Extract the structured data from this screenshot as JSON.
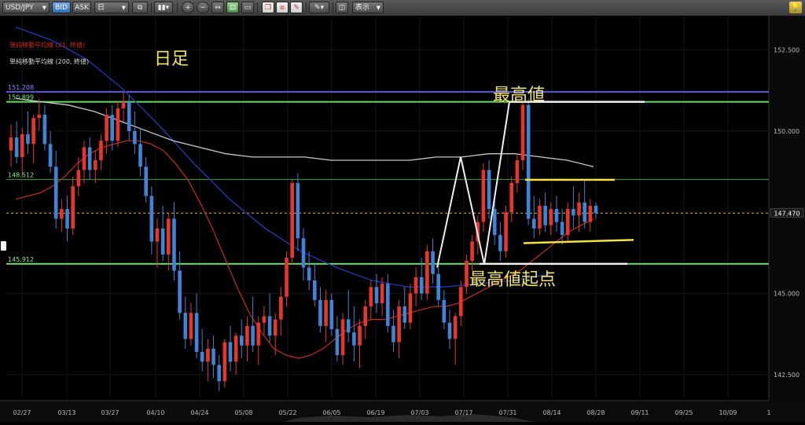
{
  "toolbar": {
    "symbol": "USD/JPY",
    "bid_label": "BID",
    "ask_label": "ASK",
    "timeframe": "日",
    "display_label": "表示",
    "icons": [
      "compare-icon",
      "chart-type-icon",
      "zoom-in-icon",
      "zoom-out-icon",
      "fit-icon",
      "window-icon",
      "copy-icon",
      "paste-icon",
      "delete-icon",
      "pen-icon",
      "screenshot-icon",
      "bulb-icon"
    ]
  },
  "colors": {
    "bull": "#e8362b",
    "bear": "#3f84d8",
    "sma21": "#cc2a1e",
    "sma200": "#c9c9c9",
    "blue_ma": "#1f3bb8",
    "resistance_line": "#5b5bd6",
    "green_line": "#5fe05f",
    "thin_green_line": "#3aa83a",
    "price_line": "#d4a23a",
    "annotation_text": "#f1e46b",
    "white_marker": "#f0f0f0",
    "yellow_marker": "#f2e23f"
  },
  "legend": {
    "sma21": "単純移動平均線 (21, 終値)",
    "sma200": "単純移動平均線 (200, 終値)"
  },
  "annotations": {
    "timeframe_label": "日足",
    "high_label": "最高値",
    "high_origin_label": "最高値起点"
  },
  "price_labels": {
    "resistance": "151.208",
    "upper_green": "150.899",
    "mid_green": "148.512",
    "lower_green": "145.912",
    "current": "147.470"
  },
  "chart_data": {
    "type": "candlestick",
    "title": "",
    "x_tick_labels": [
      "02/27",
      "03/13",
      "03/27",
      "04/10",
      "04/24",
      "05/08",
      "05/22",
      "06/05",
      "06/19",
      "07/03",
      "07/17",
      "07/31",
      "08/14",
      "08/28",
      "09/11",
      "09/25",
      "10/09",
      "1"
    ],
    "y_tick_labels": [
      "152.500",
      "150.000",
      "147.500",
      "145.000",
      "142.500"
    ],
    "ylim": [
      141.7,
      153.55
    ],
    "horizontal_levels": {
      "resistance": 151.208,
      "upper_green": 150.899,
      "mid_green": 148.512,
      "lower_green": 145.912,
      "current": 147.47
    },
    "candles": [
      [
        149.4,
        150.2,
        148.9,
        149.8
      ],
      [
        149.8,
        150.3,
        149.0,
        149.2
      ],
      [
        149.2,
        150.1,
        148.6,
        149.9
      ],
      [
        149.9,
        150.6,
        149.3,
        149.6
      ],
      [
        149.6,
        150.5,
        149.0,
        150.4
      ],
      [
        150.4,
        151.0,
        150.0,
        150.5
      ],
      [
        150.5,
        150.8,
        149.4,
        149.6
      ],
      [
        149.6,
        150.0,
        148.7,
        148.9
      ],
      [
        148.9,
        149.4,
        147.0,
        147.3
      ],
      [
        147.3,
        147.9,
        146.9,
        147.6
      ],
      [
        147.6,
        148.0,
        146.6,
        147.0
      ],
      [
        147.0,
        148.6,
        146.8,
        148.3
      ],
      [
        148.3,
        149.2,
        148.0,
        148.8
      ],
      [
        148.8,
        149.7,
        148.4,
        149.5
      ],
      [
        149.5,
        149.8,
        148.5,
        148.8
      ],
      [
        148.8,
        149.4,
        148.4,
        149.1
      ],
      [
        149.1,
        149.9,
        148.8,
        149.7
      ],
      [
        149.7,
        150.7,
        149.3,
        150.5
      ],
      [
        150.5,
        150.8,
        149.4,
        149.7
      ],
      [
        149.7,
        150.9,
        149.5,
        150.7
      ],
      [
        150.7,
        151.2,
        150.3,
        150.9
      ],
      [
        150.9,
        151.1,
        149.7,
        150.0
      ],
      [
        150.0,
        150.6,
        149.3,
        149.6
      ],
      [
        149.6,
        150.1,
        148.6,
        148.9
      ],
      [
        148.9,
        149.2,
        147.8,
        148.0
      ],
      [
        148.0,
        148.3,
        146.2,
        146.6
      ],
      [
        146.6,
        147.3,
        145.8,
        147.0
      ],
      [
        147.0,
        147.7,
        146.0,
        146.2
      ],
      [
        146.2,
        147.5,
        145.7,
        147.3
      ],
      [
        147.3,
        147.8,
        145.4,
        145.7
      ],
      [
        145.7,
        146.3,
        144.2,
        144.4
      ],
      [
        144.4,
        144.9,
        143.3,
        143.6
      ],
      [
        143.6,
        144.7,
        143.4,
        144.4
      ],
      [
        144.4,
        145.0,
        143.0,
        143.2
      ],
      [
        143.2,
        143.9,
        142.6,
        142.9
      ],
      [
        142.9,
        143.6,
        142.3,
        143.3
      ],
      [
        143.3,
        143.7,
        142.4,
        142.8
      ],
      [
        142.8,
        143.1,
        142.0,
        142.3
      ],
      [
        142.3,
        143.6,
        142.1,
        143.5
      ],
      [
        143.5,
        144.0,
        142.6,
        142.9
      ],
      [
        142.9,
        143.8,
        142.5,
        143.7
      ],
      [
        143.7,
        144.2,
        143.0,
        143.4
      ],
      [
        143.4,
        144.3,
        142.9,
        144.0
      ],
      [
        144.0,
        144.9,
        143.2,
        143.4
      ],
      [
        143.4,
        144.3,
        142.8,
        144.1
      ],
      [
        144.1,
        144.6,
        143.7,
        144.3
      ],
      [
        144.3,
        145.0,
        143.5,
        143.7
      ],
      [
        143.7,
        144.4,
        143.1,
        144.2
      ],
      [
        144.2,
        145.2,
        143.7,
        144.9
      ],
      [
        144.9,
        146.3,
        144.6,
        146.1
      ],
      [
        146.1,
        148.5,
        145.9,
        148.4
      ],
      [
        148.4,
        148.7,
        146.3,
        146.7
      ],
      [
        146.7,
        147.0,
        145.4,
        145.8
      ],
      [
        145.8,
        146.3,
        145.1,
        145.4
      ],
      [
        145.4,
        145.9,
        144.6,
        144.8
      ],
      [
        144.8,
        145.2,
        143.8,
        144.0
      ],
      [
        144.0,
        145.1,
        143.5,
        144.8
      ],
      [
        144.8,
        145.0,
        143.7,
        143.9
      ],
      [
        143.9,
        144.3,
        142.9,
        143.1
      ],
      [
        143.1,
        144.4,
        142.8,
        144.2
      ],
      [
        144.2,
        145.1,
        143.5,
        143.8
      ],
      [
        143.8,
        144.6,
        142.9,
        143.4
      ],
      [
        143.4,
        144.2,
        142.7,
        144.0
      ],
      [
        144.0,
        144.8,
        143.6,
        144.6
      ],
      [
        144.6,
        145.4,
        144.2,
        145.2
      ],
      [
        145.2,
        145.6,
        144.4,
        144.7
      ],
      [
        144.7,
        145.5,
        144.3,
        145.3
      ],
      [
        145.3,
        145.6,
        143.8,
        144.0
      ],
      [
        144.0,
        144.5,
        143.2,
        143.5
      ],
      [
        143.5,
        144.8,
        143.0,
        144.6
      ],
      [
        144.6,
        145.2,
        143.9,
        144.1
      ],
      [
        144.1,
        145.3,
        143.9,
        145.0
      ],
      [
        145.0,
        145.8,
        144.6,
        145.5
      ],
      [
        145.5,
        146.1,
        144.8,
        145.0
      ],
      [
        145.0,
        146.5,
        144.8,
        146.3
      ],
      [
        146.3,
        146.7,
        145.3,
        145.6
      ],
      [
        145.6,
        146.0,
        144.6,
        144.8
      ],
      [
        144.8,
        145.1,
        143.9,
        144.1
      ],
      [
        144.1,
        144.5,
        143.3,
        143.6
      ],
      [
        143.6,
        144.4,
        142.8,
        144.3
      ],
      [
        144.3,
        145.4,
        144.0,
        145.2
      ],
      [
        145.2,
        146.2,
        145.0,
        146.0
      ],
      [
        146.0,
        146.8,
        145.7,
        146.6
      ],
      [
        146.6,
        147.4,
        146.2,
        147.2
      ],
      [
        147.2,
        149.0,
        146.9,
        148.8
      ],
      [
        148.8,
        149.1,
        147.3,
        147.6
      ],
      [
        147.6,
        147.9,
        146.5,
        146.8
      ],
      [
        146.8,
        147.2,
        146.0,
        146.3
      ],
      [
        146.3,
        147.7,
        146.1,
        147.5
      ],
      [
        147.5,
        148.6,
        147.2,
        148.4
      ],
      [
        148.4,
        149.3,
        148.1,
        149.1
      ],
      [
        149.1,
        150.9,
        148.8,
        150.8
      ],
      [
        150.8,
        151.0,
        147.1,
        147.3
      ],
      [
        147.3,
        148.0,
        146.7,
        147.0
      ],
      [
        147.0,
        147.9,
        146.8,
        147.7
      ],
      [
        147.7,
        148.1,
        146.9,
        147.1
      ],
      [
        147.1,
        147.8,
        146.8,
        147.6
      ],
      [
        147.6,
        148.0,
        146.9,
        147.2
      ],
      [
        147.2,
        147.6,
        146.5,
        146.8
      ],
      [
        146.8,
        147.8,
        146.6,
        147.6
      ],
      [
        147.6,
        148.3,
        147.0,
        147.4
      ],
      [
        147.4,
        148.1,
        146.9,
        147.8
      ],
      [
        147.8,
        148.5,
        147.0,
        147.2
      ],
      [
        147.2,
        147.9,
        146.9,
        147.7
      ],
      [
        147.7,
        147.8,
        147.3,
        147.47
      ]
    ],
    "sma21": [
      147.9,
      148.0,
      148.1,
      148.3,
      148.6,
      149.0,
      149.3,
      149.5,
      149.6,
      149.7,
      149.7,
      149.6,
      149.4,
      149.0,
      148.5,
      147.8,
      147.0,
      146.1,
      145.2,
      144.4,
      143.8,
      143.3,
      143.1,
      143.0,
      143.1,
      143.3,
      143.6,
      143.9,
      144.1,
      144.2,
      144.2,
      144.3,
      144.4,
      144.5,
      144.6,
      144.6,
      144.7,
      144.9,
      145.1,
      145.3,
      145.5,
      145.7,
      146.0,
      146.3,
      146.6,
      146.9,
      147.1,
      147.3
    ],
    "sma200": [
      151.0,
      150.9,
      150.8,
      150.6,
      150.3,
      150.0,
      149.7,
      149.5,
      149.3,
      149.2,
      149.2,
      149.2,
      149.1,
      149.1,
      149.1,
      149.1,
      149.2,
      149.2,
      149.3,
      149.3,
      149.2,
      149.1,
      148.9
    ],
    "blue_ma": [
      153.2,
      152.8,
      152.2,
      151.3,
      150.2,
      149.0,
      147.9,
      147.0,
      146.3,
      145.8,
      145.4,
      145.2,
      145.2,
      145.3,
      145.4,
      145.6
    ]
  }
}
